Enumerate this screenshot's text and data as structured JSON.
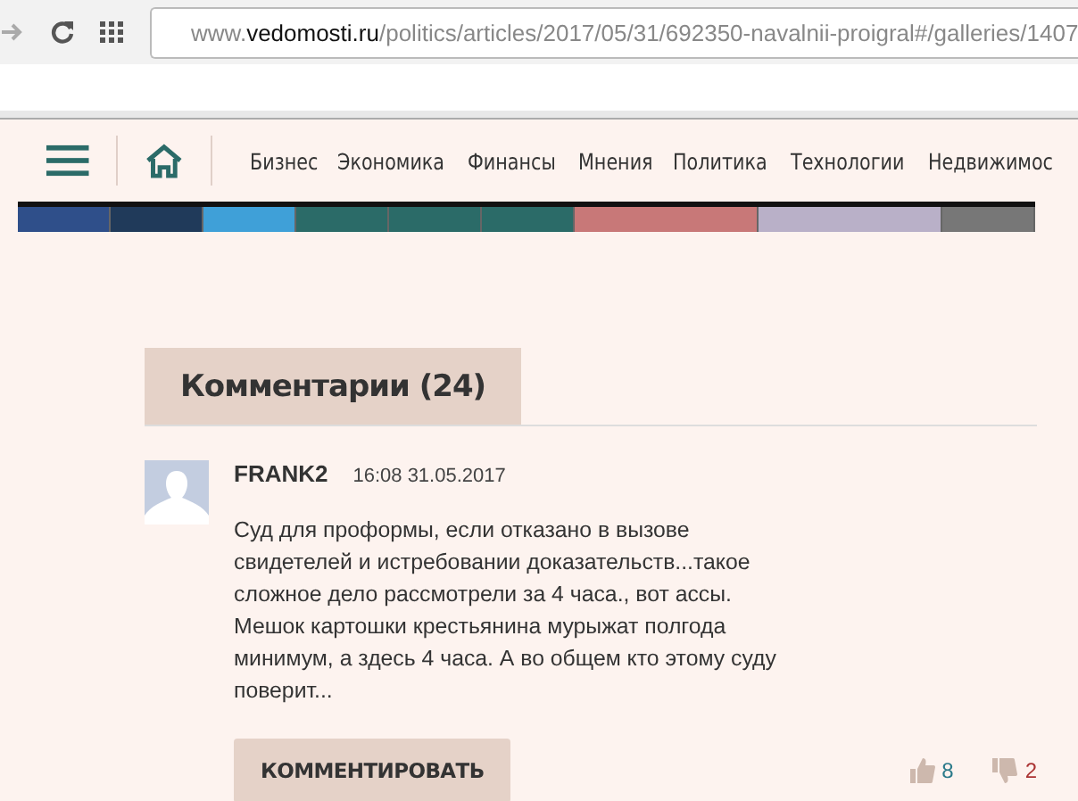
{
  "browser": {
    "url": {
      "prefix": "www.",
      "domain": "vedomosti.ru",
      "path": "/politics/articles/2017/05/31/692350-navalnii-proigral#/galleries/1407"
    }
  },
  "nav": {
    "items": [
      "Бизнес",
      "Экономика",
      "Финансы",
      "Мнения",
      "Политика",
      "Технологии",
      "Недвижимос"
    ]
  },
  "comments": {
    "title": "Комментарии (24)",
    "items": [
      {
        "author": "FRANK2",
        "time": "16:08 31.05.2017",
        "text": "Суд для проформы, если отказано в вызове свидетелей и истребовании доказательств...такое сложное дело рассмотрели за 4 часа., вот ассы. Мешок картошки крестьянина мурыжат полгода минимум, а здесь 4 часа. А во общем кто этому суду поверит...",
        "reply": "КОММЕНТИРОВАТЬ",
        "likes": "8",
        "dislikes": "2"
      }
    ]
  }
}
